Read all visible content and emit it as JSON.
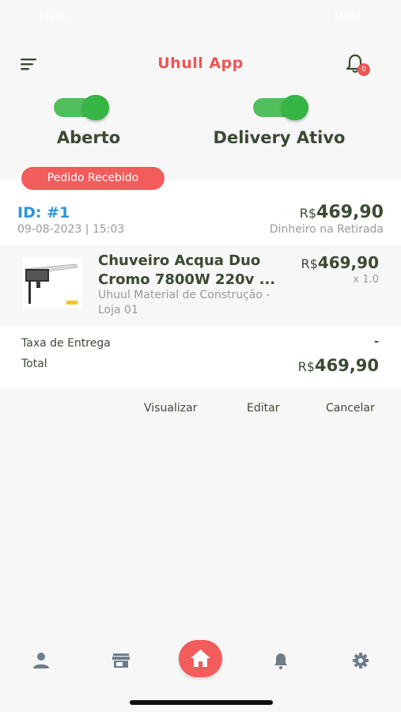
{
  "status_bar": {
    "left": "Mesa",
    "right": "Mesa"
  },
  "app": {
    "title": "Uhull App"
  },
  "notifications": {
    "count": "0"
  },
  "toggles": [
    {
      "label": "Aberto",
      "on": true
    },
    {
      "label": "Delivery Ativo",
      "on": true
    }
  ],
  "order": {
    "status": "Pedido Recebido",
    "id": "ID: #1",
    "datetime": "09-08-2023 | 15:03",
    "currency": "R$",
    "total": "469,90",
    "payment": "Dinheiro na Retirada",
    "item": {
      "name": "Chuveiro Acqua Duo Cromo 7800W 220v ...",
      "store": "Uhuul Material de Construção - Loja 01",
      "currency": "R$",
      "price": "469,90",
      "qty": "x 1.0"
    },
    "fee_label": "Taxa de Entrega",
    "fee_value": "-",
    "total_label": "Total",
    "total_currency": "R$",
    "total_value": "469,90"
  },
  "actions": {
    "view": "Visualizar",
    "edit": "Editar",
    "cancel": "Cancelar"
  },
  "bottom_nav": [
    "user-icon",
    "store-icon",
    "home-icon",
    "bell-icon",
    "gear-icon"
  ],
  "colors": {
    "accent": "#f25c5c",
    "toggle_green": "#34b544",
    "id_blue": "#2a96e0",
    "text_dark": "#3b4a33"
  }
}
